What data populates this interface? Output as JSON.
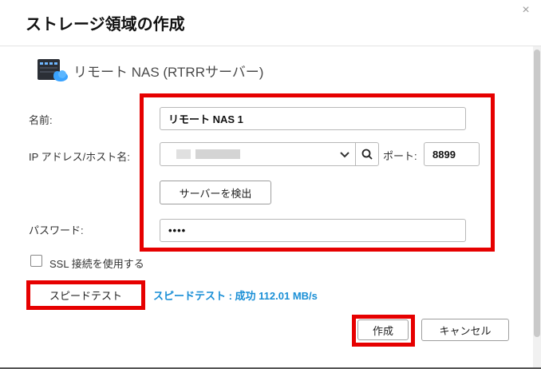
{
  "dialog": {
    "title": "ストレージ領域の作成",
    "close_glyph": "×"
  },
  "header": {
    "subtitle": "リモート NAS (RTRRサーバー)",
    "icon": "nas-cloud-icon"
  },
  "form": {
    "name_label": "名前:",
    "name_value": "リモート NAS 1",
    "host_label": "IP アドレス/ホスト名:",
    "host_value": "",
    "port_label": "ポート:",
    "port_value": "8899",
    "detect_button": "サーバーを検出",
    "password_label": "パスワード:",
    "password_value": "••••",
    "ssl_label": "SSL 接続を使用する",
    "ssl_checked": false
  },
  "speed": {
    "button": "スピードテスト",
    "result": "スピードテスト : 成功 112.01 MB/s"
  },
  "footer": {
    "create_button": "作成",
    "cancel_button": "キャンセル"
  },
  "colors": {
    "highlight": "#e60000",
    "link": "#1a8fd6"
  }
}
